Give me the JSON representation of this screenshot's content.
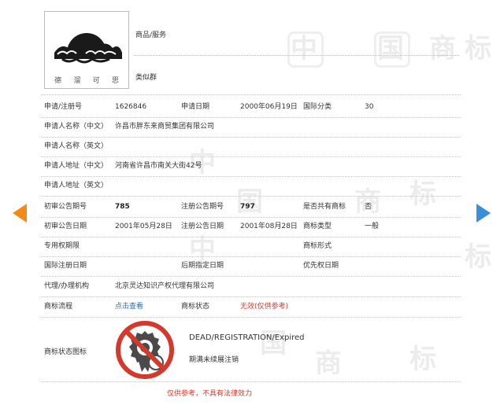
{
  "watermark": {
    "chars": [
      "中",
      "国",
      "商",
      "标"
    ]
  },
  "logo": {
    "chars": [
      "德",
      "溜",
      "可",
      "思"
    ]
  },
  "side_labels": {
    "goods_services": "商品/服务",
    "similar_group": "类似群"
  },
  "rows": {
    "reg_number": {
      "label": "申请/注册号",
      "value": "1626846"
    },
    "app_date": {
      "label": "申请日期",
      "value": "2000年06月19日"
    },
    "intl_class": {
      "label": "国际分类",
      "value": "30"
    },
    "applicant_cn": {
      "label": "申请人名称（中文）",
      "value": "许昌市胖东来商贸集团有限公司"
    },
    "applicant_en": {
      "label": "申请人名称（英文）",
      "value": ""
    },
    "address_cn": {
      "label": "申请人地址（中文）",
      "value": "河南省许昌市南关大街42号"
    },
    "address_en": {
      "label": "申请人地址（英文）",
      "value": ""
    },
    "prelim_issue": {
      "label": "初审公告期号",
      "value": "785"
    },
    "reg_issue": {
      "label": "注册公告期号",
      "value": "797"
    },
    "shared": {
      "label": "是否共有商标",
      "value": "否"
    },
    "prelim_date": {
      "label": "初审公告日期",
      "value": "2001年05月28日"
    },
    "reg_date": {
      "label": "注册公告日期",
      "value": "2001年08月28日"
    },
    "mark_type": {
      "label": "商标类型",
      "value": "一般"
    },
    "exclusive_period": {
      "label": "专用权期限",
      "value": ""
    },
    "mark_form": {
      "label": "商标形式",
      "value": ""
    },
    "intl_reg_date": {
      "label": "国际注册日期",
      "value": ""
    },
    "later_date": {
      "label": "后期指定日期",
      "value": ""
    },
    "priority_date": {
      "label": "优先权日期",
      "value": ""
    },
    "agent": {
      "label": "代理/办理机构",
      "value": "北京灵达知识产权代理有限公司"
    },
    "process": {
      "label": "商标流程",
      "link": "点击查看"
    },
    "status": {
      "label": "商标状态",
      "value": "无效",
      "note": "(仅供参考)"
    },
    "status_icon": {
      "label": "商标状态图标",
      "en": "DEAD/REGISTRATION/Expired",
      "cn": "期满未续展注销"
    }
  },
  "footer": {
    "disclaimer": "仅供参考，不具有法律效力"
  },
  "colors": {
    "accent_red": "#e03a2a",
    "link_blue": "#2a6dbf",
    "arrow_orange": "#f28a19",
    "arrow_blue": "#3b8fd9"
  }
}
